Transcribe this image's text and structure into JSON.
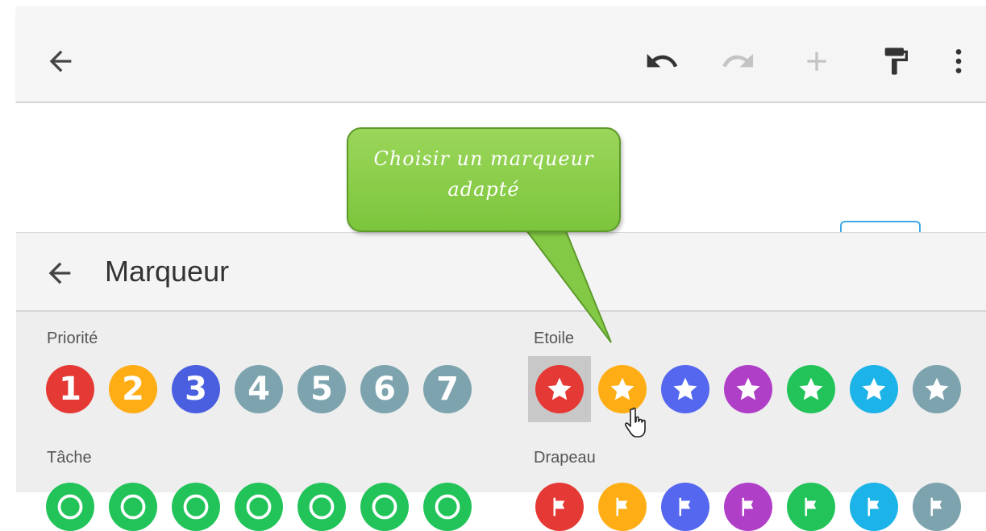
{
  "toolbar": {
    "icons": [
      "back-arrow-icon",
      "undo-icon",
      "redo-icon",
      "plus-icon",
      "paint-roller-icon",
      "more-vert-icon"
    ]
  },
  "callout": {
    "line1": "Choisir un marqueur",
    "line2": "adapté"
  },
  "panel": {
    "title": "Marqueur",
    "sections": {
      "priorite": {
        "label": "Priorité",
        "items": [
          {
            "text": "1",
            "color": "#e53935"
          },
          {
            "text": "2",
            "color": "#ffad14"
          },
          {
            "text": "3",
            "color": "#4a5fe0"
          },
          {
            "text": "4",
            "color": "#7ca3ae"
          },
          {
            "text": "5",
            "color": "#7ca3ae"
          },
          {
            "text": "6",
            "color": "#7ca3ae"
          },
          {
            "text": "7",
            "color": "#7ca3ae"
          }
        ]
      },
      "etoile": {
        "label": "Etoile",
        "colors": [
          "#e53935",
          "#ffad14",
          "#5567ef",
          "#b03fc8",
          "#22c45a",
          "#1cb3e8",
          "#7ca3ae"
        ],
        "selected_index": 0
      },
      "tache": {
        "label": "Tâche",
        "colors": [
          "#22c45a",
          "#22c45a",
          "#22c45a",
          "#22c45a",
          "#22c45a",
          "#22c45a",
          "#22c45a"
        ]
      },
      "drapeau": {
        "label": "Drapeau",
        "colors": [
          "#e53935",
          "#ffad14",
          "#5567ef",
          "#b03fc8",
          "#22c45a",
          "#1cb3e8",
          "#7ca3ae"
        ]
      }
    }
  }
}
